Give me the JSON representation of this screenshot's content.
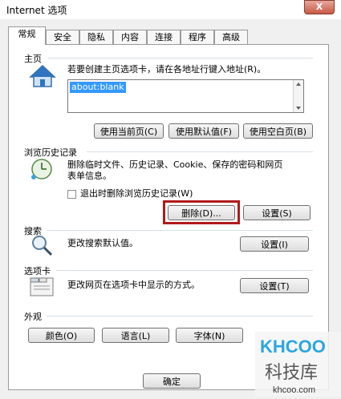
{
  "window": {
    "title": "Internet 选项",
    "close_label": "X"
  },
  "tabs": [
    "常规",
    "安全",
    "隐私",
    "内容",
    "连接",
    "程序",
    "高级"
  ],
  "home": {
    "section_label": "主页",
    "description": "若要创建主页选项卡，请在各地址行键入地址(R)。",
    "url_value": "about:blank",
    "buttons": {
      "current": "使用当前页(C)",
      "default": "使用默认值(F)",
      "blank": "使用空白页(B)"
    }
  },
  "history": {
    "section_label": "浏览历史记录",
    "description_line1": "删除临时文件、历史记录、Cookie、保存的密码和网页",
    "description_line2": "表单信息。",
    "checkbox_label": "退出时删除浏览历史记录(W)",
    "delete_button": "删除(D)...",
    "settings_button": "设置(S)"
  },
  "search": {
    "section_label": "搜索",
    "description": "更改搜索默认值。",
    "settings_button": "设置(I)"
  },
  "tabs_section": {
    "section_label": "选项卡",
    "description": "更改网页在选项卡中显示的方式。",
    "settings_button": "设置(T)"
  },
  "appearance": {
    "section_label": "外观",
    "buttons": [
      "颜色(O)",
      "语言(L)",
      "字体(N)"
    ]
  },
  "footer": {
    "ok_button": "确定"
  },
  "watermark": {
    "brand": "KHCOO",
    "name": "科技库",
    "site": "khcoo.com"
  }
}
